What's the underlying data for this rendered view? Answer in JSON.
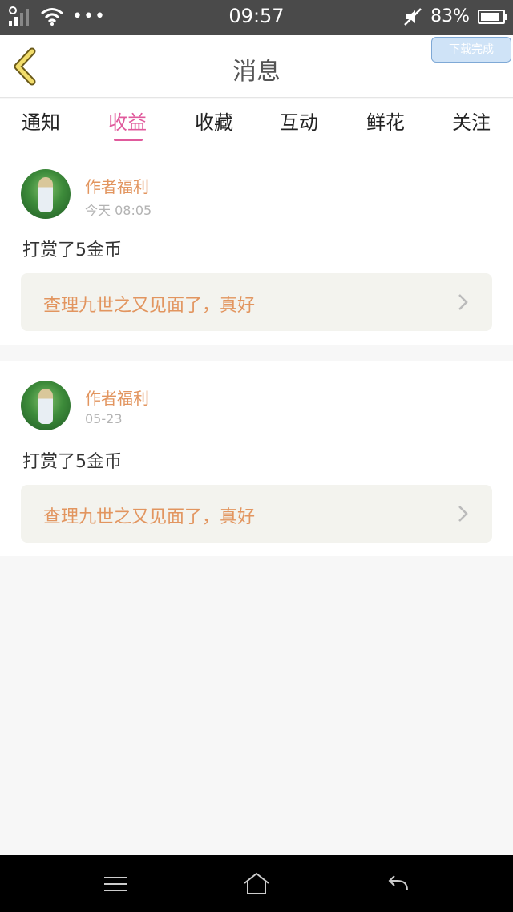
{
  "status_bar": {
    "time": "09:57",
    "battery_percent": "83%",
    "battery_level": 0.83,
    "more_glyph": "•••",
    "icons": [
      "signal-icon",
      "wifi-icon",
      "more-icon",
      "mute-icon",
      "battery-icon"
    ]
  },
  "header": {
    "title": "消息",
    "download_badge": "下载完成",
    "back_icon": "chevron-left-icon"
  },
  "tabs": [
    {
      "label": "通知",
      "active": false
    },
    {
      "label": "收益",
      "active": true
    },
    {
      "label": "收藏",
      "active": false
    },
    {
      "label": "互动",
      "active": false
    },
    {
      "label": "鲜花",
      "active": false
    },
    {
      "label": "关注",
      "active": false
    }
  ],
  "messages": [
    {
      "sender": "作者福利",
      "time": "今天 08:05",
      "text": "打赏了5金币",
      "link_text": "查理九世之又见面了，真好"
    },
    {
      "sender": "作者福利",
      "time": "05-23",
      "text": "打赏了5金币",
      "link_text": "查理九世之又见面了，真好"
    }
  ],
  "nav_bar": {
    "icons": [
      "menu-icon",
      "home-icon",
      "back-arrow-icon"
    ]
  },
  "colors": {
    "accent_pink": "#e05a9c",
    "orange_text": "#e2955f",
    "status_bar": "#4a4a4a"
  }
}
